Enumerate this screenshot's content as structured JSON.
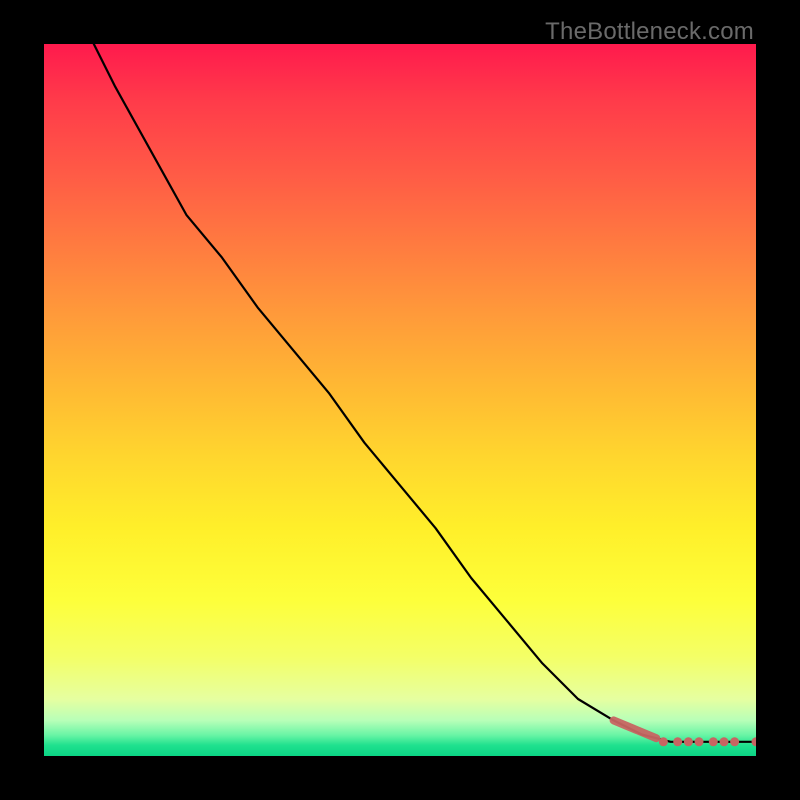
{
  "watermark": "TheBottleneck.com",
  "colors": {
    "background": "#000000",
    "curve": "#000000",
    "marker": "#c76562",
    "gradient_stops": [
      "#ff1a4d",
      "#ff3b4a",
      "#ff5a46",
      "#ff7a40",
      "#ff9a3a",
      "#ffb833",
      "#ffd62e",
      "#ffef2a",
      "#fdff3a",
      "#f4ff66",
      "#e6ffa0",
      "#b8ffb8",
      "#6cf5a6",
      "#1fe18e",
      "#0bd485"
    ]
  },
  "chart_data": {
    "type": "line",
    "title": "",
    "xlabel": "",
    "ylabel": "",
    "xlim": [
      0,
      100
    ],
    "ylim": [
      0,
      100
    ],
    "grid": false,
    "legend": false,
    "annotations": [
      "TheBottleneck.com"
    ],
    "series": [
      {
        "name": "curve",
        "x": [
          7,
          10,
          15,
          20,
          25,
          30,
          35,
          40,
          45,
          50,
          55,
          60,
          65,
          70,
          75,
          80,
          82,
          84,
          86,
          88,
          90,
          92,
          94,
          96,
          98,
          100
        ],
        "y": [
          100,
          94,
          85,
          76,
          70,
          63,
          57,
          51,
          44,
          38,
          32,
          25,
          19,
          13,
          8,
          5,
          4,
          3,
          2.5,
          2,
          2,
          2,
          2,
          2,
          2,
          2
        ]
      }
    ],
    "markers": [
      {
        "name": "highlight-segment-start",
        "x": 80,
        "y": 5
      },
      {
        "name": "highlight-segment-end",
        "x": 86,
        "y": 2.5
      },
      {
        "name": "dot",
        "x": 87,
        "y": 2
      },
      {
        "name": "dot",
        "x": 89,
        "y": 2
      },
      {
        "name": "dot",
        "x": 90.5,
        "y": 2
      },
      {
        "name": "dot",
        "x": 92,
        "y": 2
      },
      {
        "name": "dot",
        "x": 94,
        "y": 2
      },
      {
        "name": "dot",
        "x": 95.5,
        "y": 2
      },
      {
        "name": "dot",
        "x": 97,
        "y": 2
      },
      {
        "name": "dot",
        "x": 100,
        "y": 2
      }
    ]
  }
}
